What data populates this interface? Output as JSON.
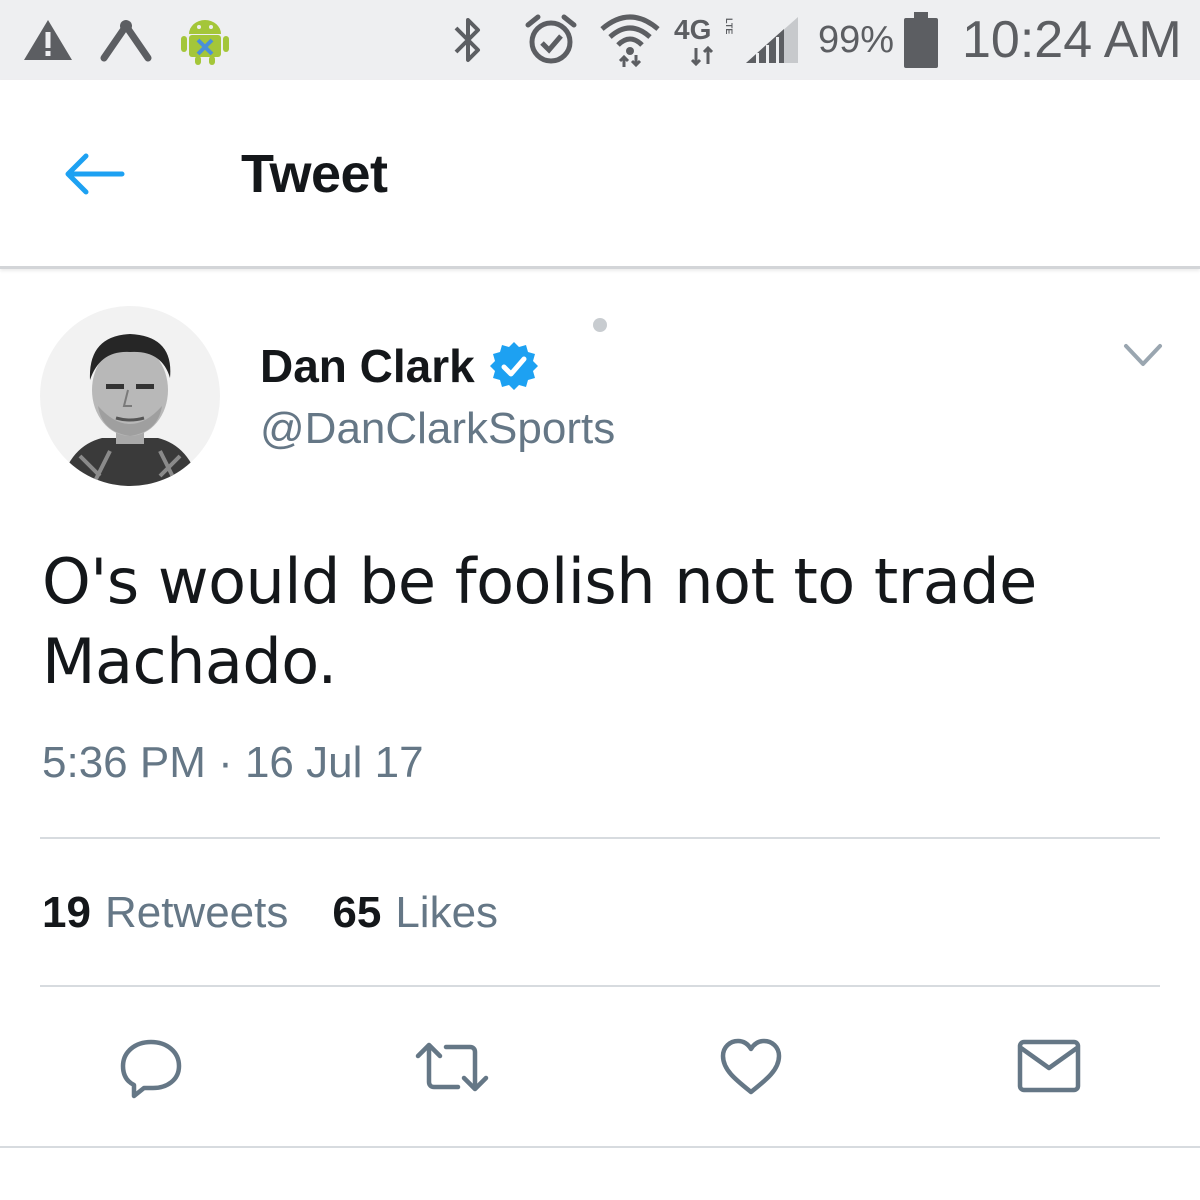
{
  "status_bar": {
    "icons": [
      "warning-icon",
      "tools-icon",
      "android-debug-icon",
      "bluetooth-icon",
      "alarm-icon",
      "wifi-icon",
      "lte-icon",
      "signal-icon",
      "battery-icon"
    ],
    "network": "4G",
    "network_sub": "LTE",
    "battery": "99%",
    "time": "10:24 AM"
  },
  "header": {
    "title": "Tweet",
    "back_icon": "back-arrow-icon"
  },
  "tweet": {
    "author_name": "Dan Clark",
    "handle": "@DanClarkSports",
    "verified": true,
    "text": "O's would be foolish not to trade Machado.",
    "timestamp": "5:36 PM · 16 Jul 17",
    "retweet_count": "19",
    "retweet_label": "Retweets",
    "like_count": "65",
    "like_label": "Likes"
  },
  "actions": [
    "reply-icon",
    "retweet-icon",
    "like-icon",
    "direct-message-icon"
  ],
  "colors": {
    "accent": "#1da1f2",
    "secondary_text": "#657786",
    "primary_text": "#14171a",
    "status_bar_bg": "#eeeff1",
    "android_green": "#a4c639"
  }
}
